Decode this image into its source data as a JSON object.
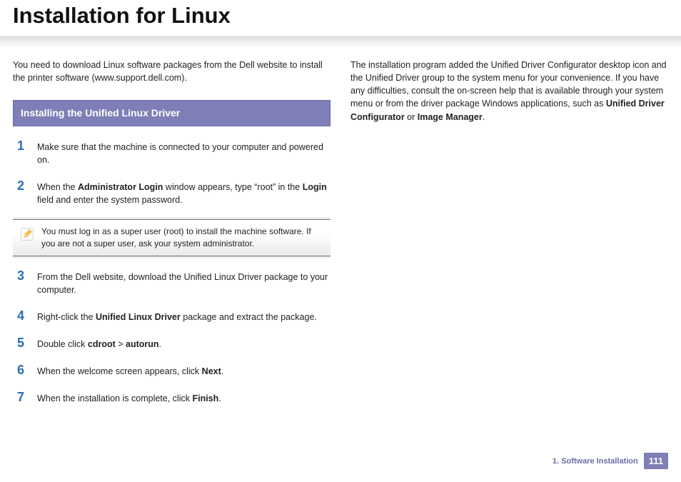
{
  "title": "Installation for Linux",
  "intro": "You need to download Linux software packages from the Dell website to install the printer software (www.support.dell.com).",
  "section_heading": "Installing the Unified Linux Driver",
  "steps": {
    "s1": {
      "num": "1",
      "text": "Make sure that the machine is connected to your computer and powered on."
    },
    "s2": {
      "num": "2",
      "pre": "When the ",
      "b1": "Administrator Login",
      "mid": " window appears, type “root” in the ",
      "b2": "Login",
      "post": " field and enter the system password."
    },
    "s3": {
      "num": "3",
      "text": "From the Dell website, download the Unified Linux Driver package to your computer."
    },
    "s4": {
      "num": "4",
      "pre": "Right-click the ",
      "b1": "Unified Linux Driver",
      "post": " package and extract the package."
    },
    "s5": {
      "num": "5",
      "pre": "Double click ",
      "b1": "cdroot",
      "mid": " > ",
      "b2": "autorun",
      "post": "."
    },
    "s6": {
      "num": "6",
      "pre": "When the welcome screen appears, click ",
      "b1": "Next",
      "post": "."
    },
    "s7": {
      "num": "7",
      "pre": "When the installation is complete, click ",
      "b1": "Finish",
      "post": "."
    }
  },
  "note": "You must log in as a super user (root) to install the machine software. If you are not a super user, ask your system administrator.",
  "right_col": {
    "pre": "The installation program added the Unified Driver Configurator desktop icon and the Unified Driver group to the system menu for your convenience. If you have any difficulties, consult the on-screen help that is available through your system menu or from the driver package Windows applications, such as ",
    "b1": "Unified Driver Configurator",
    "mid": " or ",
    "b2": "Image Manager",
    "post": "."
  },
  "footer": {
    "chapter": "1.  Software Installation",
    "page": "111"
  }
}
